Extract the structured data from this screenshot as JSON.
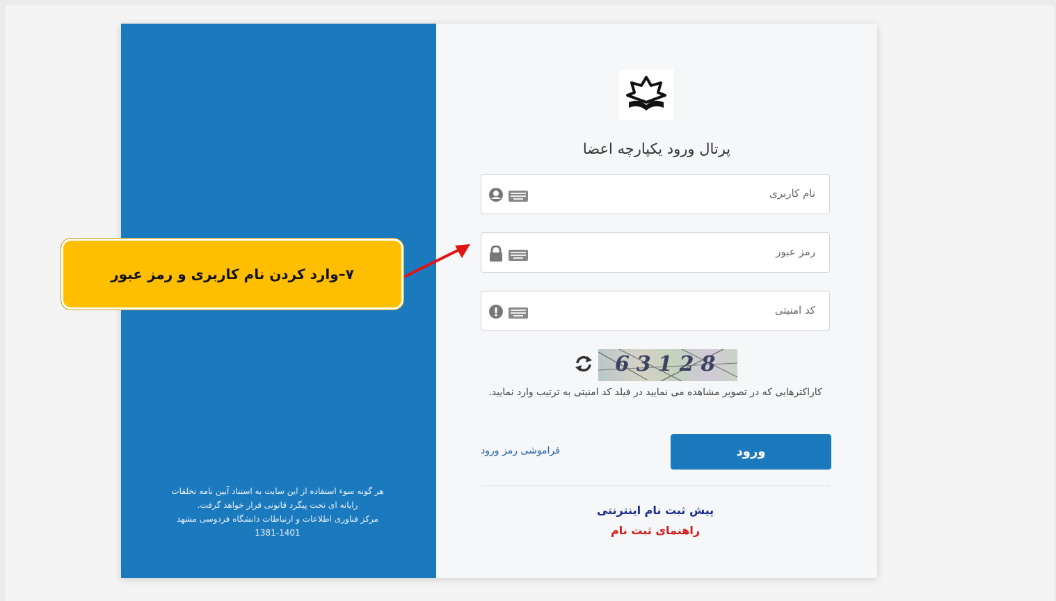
{
  "portal": {
    "title": "پرتال ورود یکپارچه اعضا"
  },
  "form": {
    "username_placeholder": "نام کاربری",
    "password_placeholder": "رمز عبور",
    "security_code_placeholder": "کد امنیتی",
    "captcha_value": "63128",
    "captcha_hint": "کاراکترهایی که در تصویر مشاهده می نمایید در فیلد کد امنیتی به ترتیب وارد نمایید.",
    "login_label": "ورود",
    "forgot_password": "فراموشی رمز ورود"
  },
  "links": {
    "pre_registration": "پیش ثبت نام اینترنتی",
    "registration_guide": "راهنمای ثبت نام"
  },
  "sidebar": {
    "footer_line1": "هر گونه سوء استفاده از این سایت به استناد آیین نامه تخلفات",
    "footer_line2": "رایانه ای تحت پیگرد قانونی قرار خواهد گرفت.",
    "footer_line3": "مرکز فناوری اطلاعات و ارتباطات دانشگاه فردوسی مشهد",
    "footer_years": "1381-1401"
  },
  "annotation": {
    "text": "۷–وارد کردن نام کاربری و رمز عبور"
  },
  "icons": {
    "logo": "lotus-book-icon",
    "user": "user-icon",
    "lock": "lock-icon",
    "alert": "exclamation-icon",
    "keyboard": "keyboard-icon",
    "refresh": "refresh-icon"
  },
  "colors": {
    "primary_blue": "#1b79be",
    "callout_yellow": "#ffbf00",
    "arrow_red": "#e01414",
    "guide_red": "#d11a1a",
    "pre_reg_navy": "#1a2a8a"
  }
}
